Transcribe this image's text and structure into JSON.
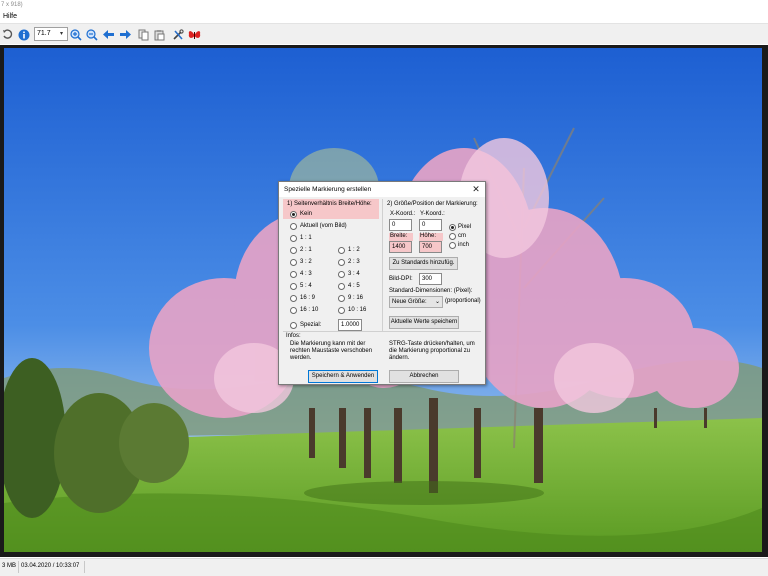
{
  "window": {
    "title_fragment": "7 x 918)"
  },
  "menu": {
    "help": "Hilfe"
  },
  "toolbar": {
    "zoom_value": "71.7",
    "icons": [
      "undo-icon",
      "info-icon",
      "zoom-in-icon",
      "zoom-out-icon",
      "prev-arrow-icon",
      "next-arrow-icon",
      "copy-icon",
      "paste-icon",
      "tools-icon",
      "butterfly-icon"
    ]
  },
  "status": {
    "size": "3 MB",
    "datetime": "03.04.2020 / 10:33:07"
  },
  "dialog": {
    "title": "Spezielle Markierung erstellen",
    "section1_title": "1) Seitenverhältnis Breite/Höhe:",
    "ratios": {
      "none": "Kein",
      "current": "Aktuell (vom Bild)",
      "r1_1": "1 : 1",
      "r2_1": "2 : 1",
      "r1_2": "1 : 2",
      "r3_2": "3 : 2",
      "r2_3": "2 : 3",
      "r4_3": "4 : 3",
      "r3_4": "3 : 4",
      "r5_4": "5 : 4",
      "r4_5": "4 : 5",
      "r16_9": "16 : 9",
      "r9_16": "9 : 16",
      "r16_10": "16 : 10",
      "r10_16": "10 : 16",
      "special": "Spezial:",
      "special_value": "1.0000"
    },
    "section2_title": "2) Größe/Position der Markierung:",
    "x_label": "X-Koord.:",
    "y_label": "Y-Koord.:",
    "x_value": "0",
    "y_value": "0",
    "width_label": "Breite:",
    "height_label": "Höhe:",
    "width_value": "1400",
    "height_value": "700",
    "unit_pixel": "Pixel",
    "unit_cm": "cm",
    "unit_inch": "inch",
    "add_standard_button": "Zu Standards hinzufüg.",
    "dpi_label": "Bild-DPI:",
    "dpi_value": "300",
    "std_dims_label": "Standard-Dimensionen: (Pixel):",
    "std_dims_select": "Neue Größe:",
    "proportional": "(proportional)",
    "current_values_button": "Aktuelle Werte speichern",
    "info_label": "Infos:",
    "info_left": "Die Markierung kann mit der rechten Maustaste verschoben werden.",
    "info_right": "STRG-Taste drücken/halten, um die Markierung proportional zu ändern.",
    "save_button": "Speichern & Anwenden",
    "cancel_button": "Abbrechen"
  }
}
